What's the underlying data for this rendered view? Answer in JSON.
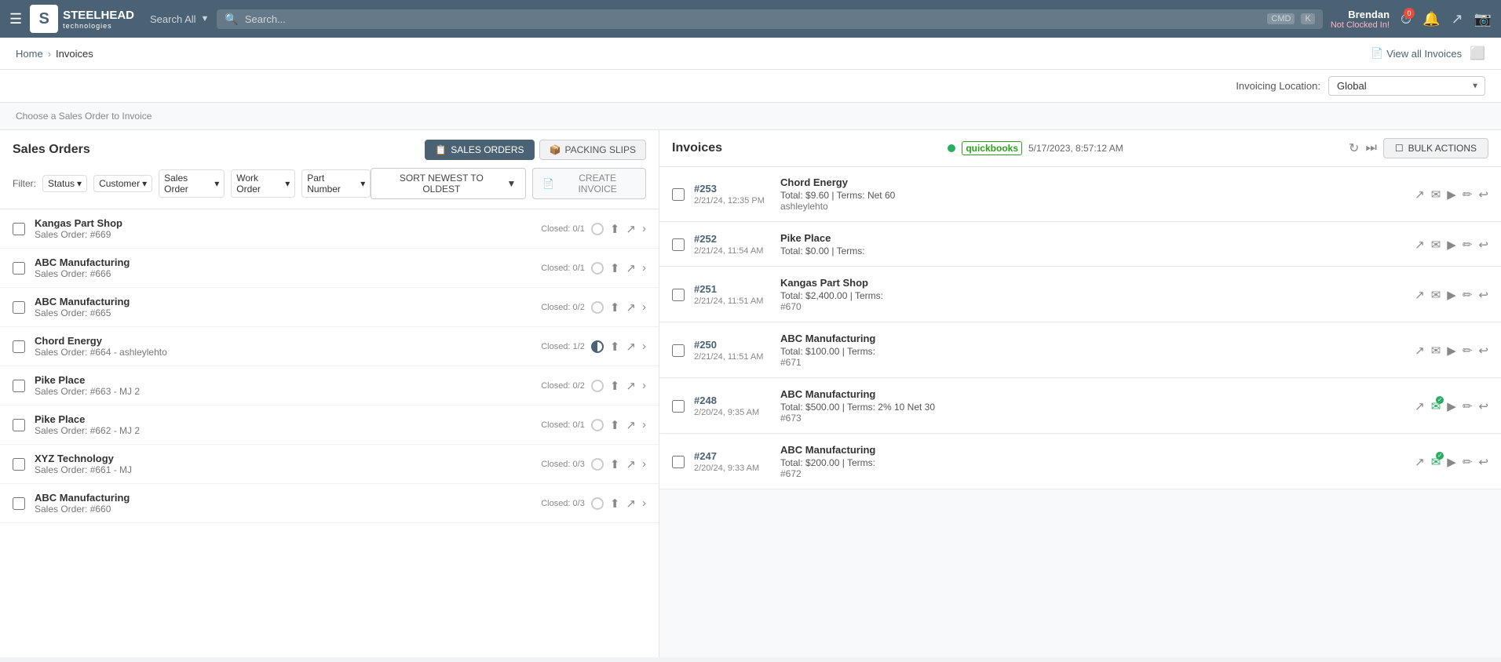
{
  "topnav": {
    "brand": "STEELHEAD",
    "brand_sub": "technologies",
    "search_label": "Search All",
    "search_placeholder": "Search...",
    "kbd1": "CMD",
    "kbd2": "K",
    "user_name": "Brendan",
    "user_status": "Not Clocked In!",
    "timer_badge": "0"
  },
  "breadcrumb": {
    "home": "Home",
    "sep": "›",
    "current": "Invoices",
    "view_all": "View all Invoices"
  },
  "location": {
    "label": "Invoicing Location:",
    "value": "Global"
  },
  "hint": {
    "text": "Choose a Sales Order to Invoice"
  },
  "left": {
    "title": "Sales Orders",
    "tabs": [
      {
        "id": "sales-orders",
        "label": "SALES ORDERS",
        "active": true,
        "icon": "📋"
      },
      {
        "id": "packing-slips",
        "label": "PACKING SLIPS",
        "active": false,
        "icon": "📦"
      }
    ],
    "sort_label": "SORT NEWEST TO OLDEST",
    "create_label": "CREATE INVOICE",
    "filter_label": "Filter:",
    "filters": [
      "Status",
      "Customer",
      "Sales Order",
      "Work Order",
      "Part Number"
    ],
    "orders": [
      {
        "id": "so1",
        "company": "Kangas Part Shop",
        "order": "Sales Order: #669",
        "status": "Closed: 0/1",
        "circle": ""
      },
      {
        "id": "so2",
        "company": "ABC Manufacturing",
        "order": "Sales Order: #666",
        "status": "Closed: 0/1",
        "circle": ""
      },
      {
        "id": "so3",
        "company": "ABC Manufacturing",
        "order": "Sales Order: #665",
        "status": "Closed: 0/2",
        "circle": ""
      },
      {
        "id": "so4",
        "company": "Chord Energy",
        "order": "Sales Order: #664 - ashleylehto",
        "status": "Closed: 1/2",
        "circle": "half"
      },
      {
        "id": "so5",
        "company": "Pike Place",
        "order": "Sales Order: #663 - MJ 2",
        "status": "Closed: 0/2",
        "circle": ""
      },
      {
        "id": "so6",
        "company": "Pike Place",
        "order": "Sales Order: #662 - MJ 2",
        "status": "Closed: 0/1",
        "circle": ""
      },
      {
        "id": "so7",
        "company": "XYZ Technology",
        "order": "Sales Order: #661 - MJ",
        "status": "Closed: 0/3",
        "circle": ""
      },
      {
        "id": "so8",
        "company": "ABC Manufacturing",
        "order": "Sales Order: #660",
        "status": "Closed: 0/3",
        "circle": ""
      }
    ]
  },
  "right": {
    "title": "Invoices",
    "qb_time": "5/17/2023, 8:57:12 AM",
    "bulk_actions": "BULK ACTIONS",
    "invoices": [
      {
        "id": "inv253",
        "num": "#253",
        "date": "2/21/24, 12:35 PM",
        "company": "Chord Energy",
        "total": "Total: $9.60 | Terms: Net 60",
        "ref": "ashleylehto",
        "email_badge": false
      },
      {
        "id": "inv252",
        "num": "#252",
        "date": "2/21/24, 11:54 AM",
        "company": "Pike Place",
        "total": "Total: $0.00 | Terms:",
        "ref": "",
        "email_badge": false
      },
      {
        "id": "inv251",
        "num": "#251",
        "date": "2/21/24, 11:51 AM",
        "company": "Kangas Part Shop",
        "total": "Total: $2,400.00 | Terms:",
        "ref": "#670",
        "email_badge": false
      },
      {
        "id": "inv250",
        "num": "#250",
        "date": "2/21/24, 11:51 AM",
        "company": "ABC Manufacturing",
        "total": "Total: $100.00 | Terms:",
        "ref": "#671",
        "email_badge": false
      },
      {
        "id": "inv248",
        "num": "#248",
        "date": "2/20/24, 9:35 AM",
        "company": "ABC Manufacturing",
        "total": "Total: $500.00 | Terms: 2% 10 Net 30",
        "ref": "#673",
        "email_badge": true
      },
      {
        "id": "inv247",
        "num": "#247",
        "date": "2/20/24, 9:33 AM",
        "company": "ABC Manufacturing",
        "total": "Total: $200.00 | Terms:",
        "ref": "#672",
        "email_badge": true
      }
    ]
  }
}
